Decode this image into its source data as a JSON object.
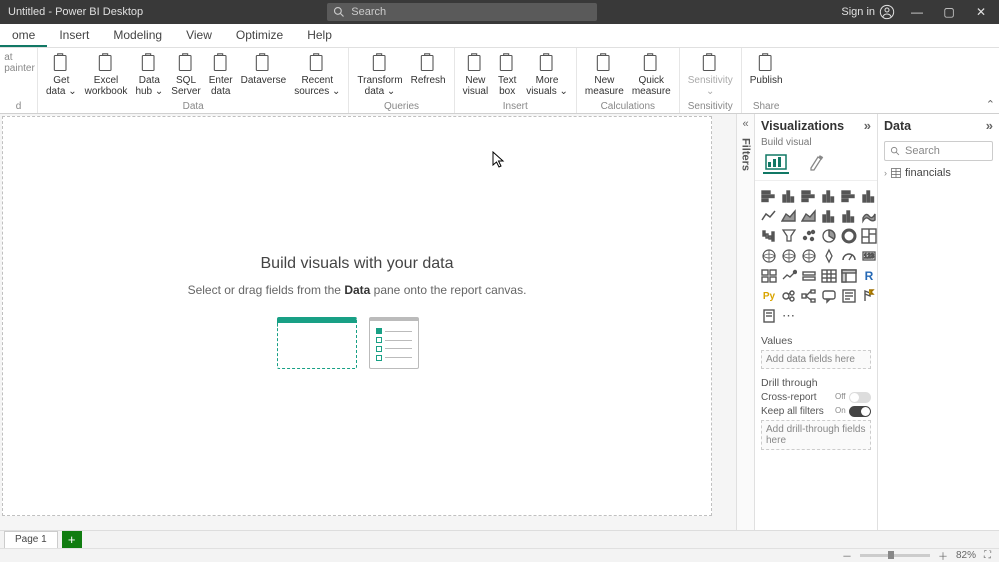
{
  "titlebar": {
    "title": "Untitled - Power BI Desktop",
    "search_placeholder": "Search",
    "signin": "Sign in"
  },
  "menu": {
    "tabs": [
      "ome",
      "Insert",
      "Modeling",
      "View",
      "Optimize",
      "Help"
    ],
    "active": 0
  },
  "ribbon": {
    "clipboard": {
      "paste": "",
      "format_painter": "at painter",
      "label": "d"
    },
    "data_group": {
      "items": [
        {
          "label": "Get\ndata ⌄"
        },
        {
          "label": "Excel\nworkbook"
        },
        {
          "label": "Data\nhub ⌄"
        },
        {
          "label": "SQL\nServer"
        },
        {
          "label": "Enter\ndata"
        },
        {
          "label": "Dataverse"
        },
        {
          "label": "Recent\nsources ⌄"
        }
      ],
      "label": "Data"
    },
    "queries_group": {
      "items": [
        {
          "label": "Transform\ndata ⌄"
        },
        {
          "label": "Refresh"
        }
      ],
      "label": "Queries"
    },
    "insert_group": {
      "items": [
        {
          "label": "New\nvisual"
        },
        {
          "label": "Text\nbox"
        },
        {
          "label": "More\nvisuals ⌄"
        }
      ],
      "label": "Insert"
    },
    "calc_group": {
      "items": [
        {
          "label": "New\nmeasure"
        },
        {
          "label": "Quick\nmeasure"
        }
      ],
      "label": "Calculations"
    },
    "sens_group": {
      "items": [
        {
          "label": "Sensitivity\n⌄"
        }
      ],
      "label": "Sensitivity"
    },
    "share_group": {
      "items": [
        {
          "label": "Publish"
        }
      ],
      "label": "Share"
    }
  },
  "canvas": {
    "heading": "Build visuals with your data",
    "sub_pre": "Select or drag fields from the ",
    "sub_bold": "Data",
    "sub_post": " pane onto the report canvas."
  },
  "filters": {
    "label": "Filters"
  },
  "viz": {
    "title": "Visualizations",
    "subtitle": "Build visual",
    "values_hdr": "Values",
    "values_placeholder": "Add data fields here",
    "drill_hdr": "Drill through",
    "cross_report": "Cross-report",
    "keep_filters": "Keep all filters",
    "cross_state": "Off",
    "keep_state": "On",
    "drill_placeholder": "Add drill-through fields here",
    "items": [
      "stacked-bar",
      "stacked-column",
      "clustered-bar",
      "clustered-column",
      "100-bar",
      "100-column",
      "line",
      "area",
      "stacked-area",
      "line-column",
      "line-column2",
      "ribbon",
      "waterfall",
      "funnel",
      "scatter",
      "pie",
      "donut",
      "treemap",
      "map",
      "filled-map",
      "azure-map",
      "arcgis",
      "gauge",
      "card",
      "multi-card",
      "kpi",
      "slicer",
      "table",
      "matrix",
      "r",
      "py",
      "key-influencers",
      "decomposition",
      "qna",
      "narrative",
      "goals",
      "paginated",
      "more"
    ]
  },
  "data": {
    "title": "Data",
    "search_placeholder": "Search",
    "tables": [
      "financials"
    ]
  },
  "pages": {
    "current": "Page 1"
  },
  "status": {
    "zoom": "82%"
  }
}
